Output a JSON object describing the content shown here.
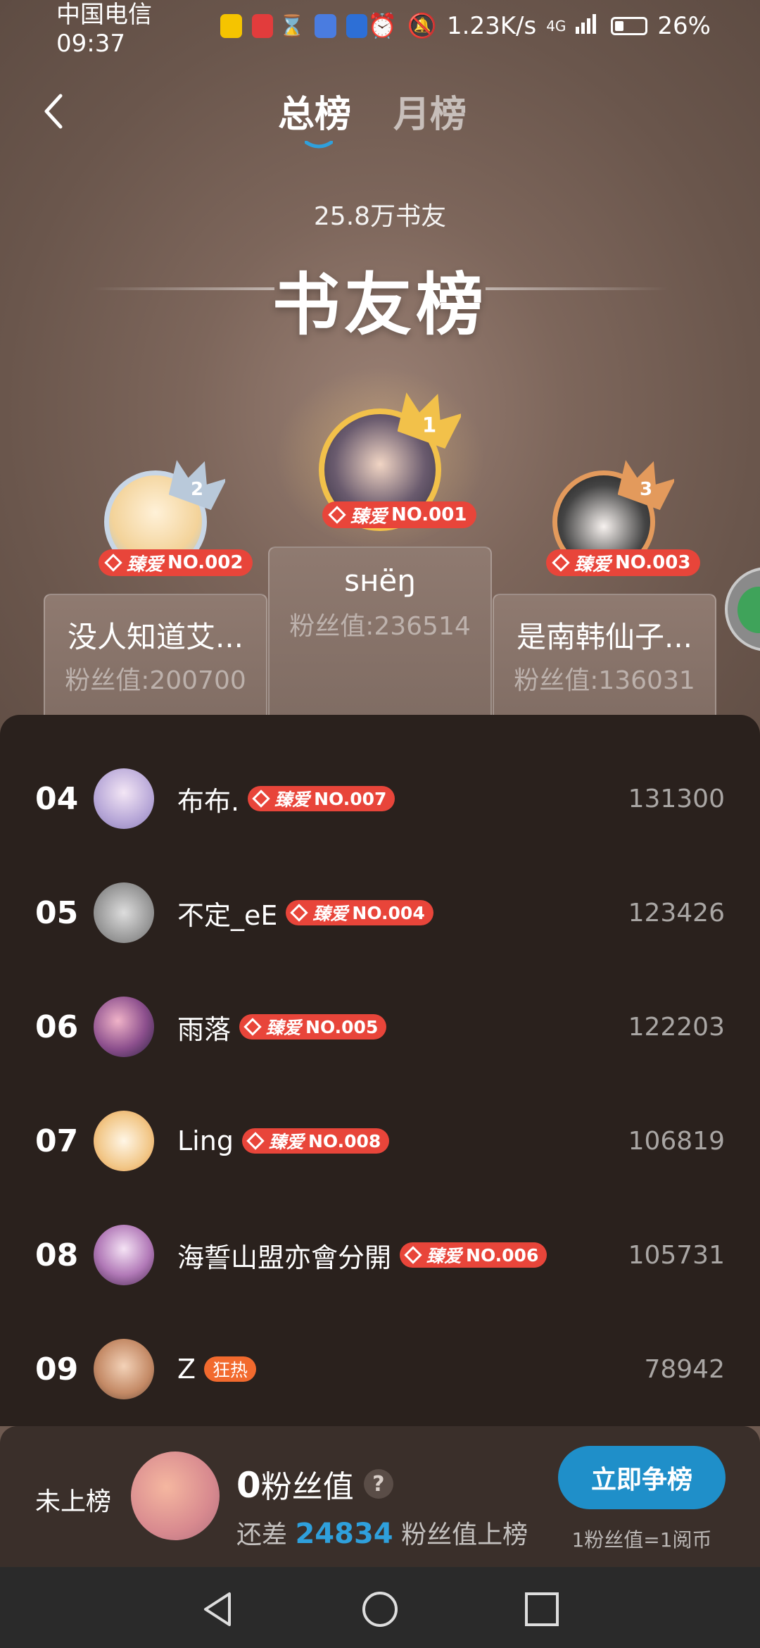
{
  "status_bar": {
    "carrier_time": "中国电信 09:37",
    "speed": "1.23K/s",
    "network": "4G",
    "battery": "26%",
    "icons": [
      "weibo-icon",
      "huawei-icon",
      "hourglass-icon",
      "music-icon",
      "bank-icon",
      "alarm-icon",
      "mute-icon",
      "signal-icon",
      "battery-icon"
    ]
  },
  "nav": {
    "tabs": [
      {
        "label": "总榜",
        "active": true
      },
      {
        "label": "月榜",
        "active": false
      }
    ]
  },
  "header": {
    "fan_count": "25.8万书友",
    "board_title_a": "书",
    "board_title_b": "友榜"
  },
  "podium": {
    "first": {
      "name": "sʜëŋ",
      "value": "粉丝值:236514",
      "badge_brand": "臻爱",
      "badge_no": "NO.001",
      "rank": "1"
    },
    "second": {
      "name": "没人知道艾...",
      "value": "粉丝值:200700",
      "badge_brand": "臻爱",
      "badge_no": "NO.002",
      "rank": "2"
    },
    "third": {
      "name": "是南韩仙子...",
      "value": "粉丝值:136031",
      "badge_brand": "臻爱",
      "badge_no": "NO.003",
      "rank": "3"
    }
  },
  "list": [
    {
      "rank": "04",
      "name": "布布.",
      "badge_brand": "臻爱",
      "badge_no": "NO.007",
      "score": "131300"
    },
    {
      "rank": "05",
      "name": "不定_eE",
      "badge_brand": "臻爱",
      "badge_no": "NO.004",
      "score": "123426"
    },
    {
      "rank": "06",
      "name": "雨落",
      "badge_brand": "臻爱",
      "badge_no": "NO.005",
      "score": "122203"
    },
    {
      "rank": "07",
      "name": "Ling",
      "badge_brand": "臻爱",
      "badge_no": "NO.008",
      "score": "106819"
    },
    {
      "rank": "08",
      "name": "海誓山盟亦會分開",
      "badge_brand": "臻爱",
      "badge_no": "NO.006",
      "score": "105731"
    },
    {
      "rank": "09",
      "name": "Z",
      "badge_hot": "狂热",
      "score": "78942"
    }
  ],
  "my": {
    "status": "未上榜",
    "score_num": "0",
    "score_label": "粉丝值",
    "gap_prefix": "还差",
    "gap_num": "24834",
    "gap_suffix": "粉丝值上榜",
    "compete_label": "立即争榜",
    "rate": "1粉丝值=1阅币"
  },
  "colors": {
    "badge": "#e8453a",
    "accent": "#1f8fc9",
    "gold": "#f2c14a",
    "silver": "#b9c9da",
    "bronze": "#e39a5c"
  }
}
